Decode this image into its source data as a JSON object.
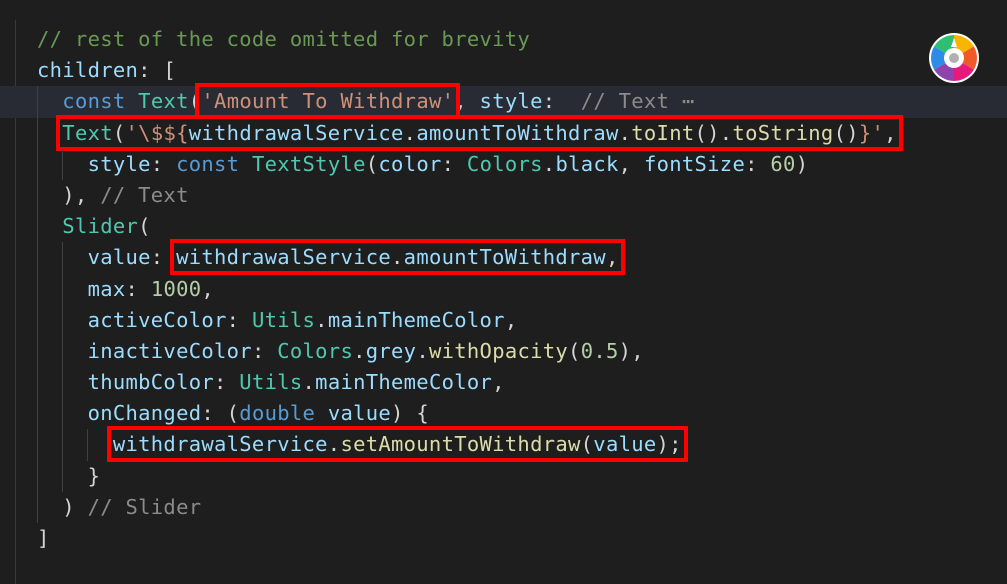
{
  "editor": {
    "lines": [
      {
        "tokens": [
          {
            "t": "// rest of the code omitted for brevity",
            "c": "cmt"
          }
        ]
      },
      {
        "tokens": [
          {
            "t": "children",
            "c": "var"
          },
          {
            "t": ": [",
            "c": "pun"
          }
        ]
      },
      {
        "current": true,
        "tokens": [
          {
            "t": "  ",
            "c": "pun"
          },
          {
            "t": "const",
            "c": "kw"
          },
          {
            "t": " ",
            "c": "pun"
          },
          {
            "t": "Text",
            "c": "cls"
          },
          {
            "t": "(",
            "c": "pun"
          },
          {
            "t": "'Amount To Withdraw'",
            "c": "str",
            "box": true
          },
          {
            "t": ", ",
            "c": "pun"
          },
          {
            "t": "style",
            "c": "var"
          },
          {
            "t": ":  ",
            "c": "pun"
          },
          {
            "t": "// Text ⋯",
            "c": "hint"
          }
        ]
      },
      {
        "tokens": [
          {
            "t": "  ",
            "c": "pun"
          },
          {
            "group": true,
            "box": true,
            "tokens": [
              {
                "t": "Text",
                "c": "cls"
              },
              {
                "t": "(",
                "c": "pun"
              },
              {
                "t": "'\\$${",
                "c": "str"
              },
              {
                "t": "withdrawalService",
                "c": "var"
              },
              {
                "t": ".",
                "c": "pun"
              },
              {
                "t": "amountToWithdraw",
                "c": "var"
              },
              {
                "t": ".",
                "c": "pun"
              },
              {
                "t": "toInt",
                "c": "fn"
              },
              {
                "t": "().",
                "c": "pun"
              },
              {
                "t": "toString",
                "c": "fn"
              },
              {
                "t": "()",
                "c": "pun"
              },
              {
                "t": "}'",
                "c": "str"
              },
              {
                "t": ",",
                "c": "pun"
              }
            ]
          }
        ]
      },
      {
        "tokens": [
          {
            "t": "    ",
            "c": "pun"
          },
          {
            "t": "style",
            "c": "var"
          },
          {
            "t": ": ",
            "c": "pun"
          },
          {
            "t": "const",
            "c": "kw"
          },
          {
            "t": " ",
            "c": "pun"
          },
          {
            "t": "TextStyle",
            "c": "cls"
          },
          {
            "t": "(",
            "c": "pun"
          },
          {
            "t": "color",
            "c": "var"
          },
          {
            "t": ": ",
            "c": "pun"
          },
          {
            "t": "Colors",
            "c": "cls"
          },
          {
            "t": ".",
            "c": "pun"
          },
          {
            "t": "black",
            "c": "var"
          },
          {
            "t": ", ",
            "c": "pun"
          },
          {
            "t": "fontSize",
            "c": "var"
          },
          {
            "t": ": ",
            "c": "pun"
          },
          {
            "t": "60",
            "c": "num"
          },
          {
            "t": ")",
            "c": "pun"
          }
        ]
      },
      {
        "tokens": [
          {
            "t": "  ), ",
            "c": "pun"
          },
          {
            "t": "// Text",
            "c": "hint"
          }
        ]
      },
      {
        "tokens": [
          {
            "t": "  ",
            "c": "pun"
          },
          {
            "t": "Slider",
            "c": "cls"
          },
          {
            "t": "(",
            "c": "pun"
          }
        ]
      },
      {
        "tokens": [
          {
            "t": "    ",
            "c": "pun"
          },
          {
            "t": "value",
            "c": "var"
          },
          {
            "t": ": ",
            "c": "pun"
          },
          {
            "group": true,
            "box": true,
            "tokens": [
              {
                "t": "withdrawalService",
                "c": "var"
              },
              {
                "t": ".",
                "c": "pun"
              },
              {
                "t": "amountToWithdraw",
                "c": "var"
              },
              {
                "t": ",",
                "c": "pun"
              }
            ]
          }
        ]
      },
      {
        "tokens": [
          {
            "t": "    ",
            "c": "pun"
          },
          {
            "t": "max",
            "c": "var"
          },
          {
            "t": ": ",
            "c": "pun"
          },
          {
            "t": "1000",
            "c": "num"
          },
          {
            "t": ",",
            "c": "pun"
          }
        ]
      },
      {
        "tokens": [
          {
            "t": "    ",
            "c": "pun"
          },
          {
            "t": "activeColor",
            "c": "var"
          },
          {
            "t": ": ",
            "c": "pun"
          },
          {
            "t": "Utils",
            "c": "cls"
          },
          {
            "t": ".",
            "c": "pun"
          },
          {
            "t": "mainThemeColor",
            "c": "var"
          },
          {
            "t": ",",
            "c": "pun"
          }
        ]
      },
      {
        "tokens": [
          {
            "t": "    ",
            "c": "pun"
          },
          {
            "t": "inactiveColor",
            "c": "var"
          },
          {
            "t": ": ",
            "c": "pun"
          },
          {
            "t": "Colors",
            "c": "cls"
          },
          {
            "t": ".",
            "c": "pun"
          },
          {
            "t": "grey",
            "c": "var"
          },
          {
            "t": ".",
            "c": "pun"
          },
          {
            "t": "withOpacity",
            "c": "fn"
          },
          {
            "t": "(",
            "c": "pun"
          },
          {
            "t": "0.5",
            "c": "num"
          },
          {
            "t": "),",
            "c": "pun"
          }
        ]
      },
      {
        "tokens": [
          {
            "t": "    ",
            "c": "pun"
          },
          {
            "t": "thumbColor",
            "c": "var"
          },
          {
            "t": ": ",
            "c": "pun"
          },
          {
            "t": "Utils",
            "c": "cls"
          },
          {
            "t": ".",
            "c": "pun"
          },
          {
            "t": "mainThemeColor",
            "c": "var"
          },
          {
            "t": ",",
            "c": "pun"
          }
        ]
      },
      {
        "tokens": [
          {
            "t": "    ",
            "c": "pun"
          },
          {
            "t": "onChanged",
            "c": "var"
          },
          {
            "t": ": (",
            "c": "pun"
          },
          {
            "t": "double",
            "c": "kw"
          },
          {
            "t": " ",
            "c": "pun"
          },
          {
            "t": "value",
            "c": "var"
          },
          {
            "t": ") {",
            "c": "pun"
          }
        ]
      },
      {
        "tokens": [
          {
            "t": "      ",
            "c": "pun"
          },
          {
            "group": true,
            "box": true,
            "tokens": [
              {
                "t": "withdrawalService",
                "c": "var"
              },
              {
                "t": ".",
                "c": "pun"
              },
              {
                "t": "setAmountToWithdraw",
                "c": "fn"
              },
              {
                "t": "(",
                "c": "pun"
              },
              {
                "t": "value",
                "c": "var"
              },
              {
                "t": ");",
                "c": "pun"
              }
            ]
          }
        ]
      },
      {
        "tokens": [
          {
            "t": "    }",
            "c": "pun"
          }
        ]
      },
      {
        "tokens": [
          {
            "t": "  ) ",
            "c": "pun"
          },
          {
            "t": "// Slider",
            "c": "hint"
          }
        ]
      },
      {
        "tokens": [
          {
            "t": "]",
            "c": "pun"
          }
        ]
      }
    ]
  },
  "theme": {
    "background": "#1e1e1e",
    "highlight_box": "#ff0000"
  },
  "overlay": {
    "icon": "color-wheel-icon"
  }
}
